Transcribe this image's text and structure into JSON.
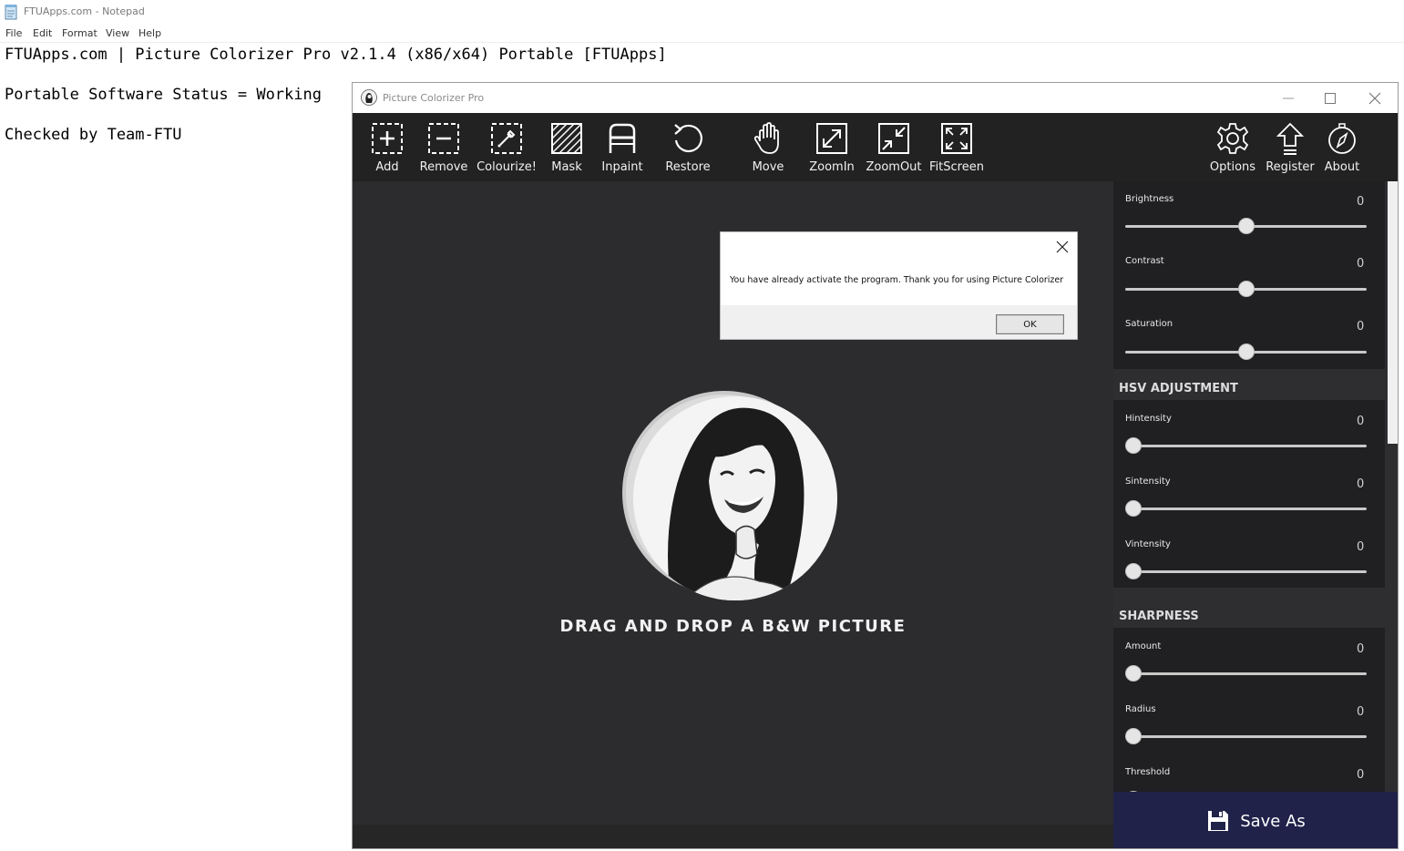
{
  "notepad": {
    "title": "FTUApps.com - Notepad",
    "menu": [
      "File",
      "Edit",
      "Format",
      "View",
      "Help"
    ],
    "lines": [
      "FTUApps.com | Picture Colorizer Pro v2.1.4 (x86/x64) Portable [FTUApps]",
      "Portable Software Status = Working",
      "Checked by Team-FTU"
    ]
  },
  "app": {
    "title": "Picture Colorizer Pro",
    "toolbar": {
      "add": "Add",
      "remove": "Remove",
      "colourize": "Colourize!",
      "mask": "Mask",
      "inpaint": "Inpaint",
      "restore": "Restore",
      "move": "Move",
      "zoomin": "ZoomIn",
      "zoomout": "ZoomOut",
      "fitscreen": "FitScreen",
      "options": "Options",
      "register": "Register",
      "about": "About"
    },
    "drop_text": "DRAG AND DROP A B&W PICTURE",
    "panel": {
      "basic": [
        {
          "label": "Brightness",
          "value": "0",
          "level": 0.5
        },
        {
          "label": "Contrast",
          "value": "0",
          "level": 0.5
        },
        {
          "label": "Saturation",
          "value": "0",
          "level": 0.5
        }
      ],
      "hsv_title": "HSV ADJUSTMENT",
      "hsv": [
        {
          "label": "Hintensity",
          "value": "0",
          "level": 0
        },
        {
          "label": "Sintensity",
          "value": "0",
          "level": 0
        },
        {
          "label": "Vintensity",
          "value": "0",
          "level": 0
        }
      ],
      "sharp_title": "SHARPNESS",
      "sharp": [
        {
          "label": "Amount",
          "value": "0",
          "level": 0
        },
        {
          "label": "Radius",
          "value": "0",
          "level": 0
        },
        {
          "label": "Threshold",
          "value": "0",
          "level": 0
        }
      ]
    },
    "save_as": "Save As"
  },
  "dialog": {
    "message": "You have already activate the program. Thank you for using Picture Colorizer",
    "ok": "OK"
  }
}
